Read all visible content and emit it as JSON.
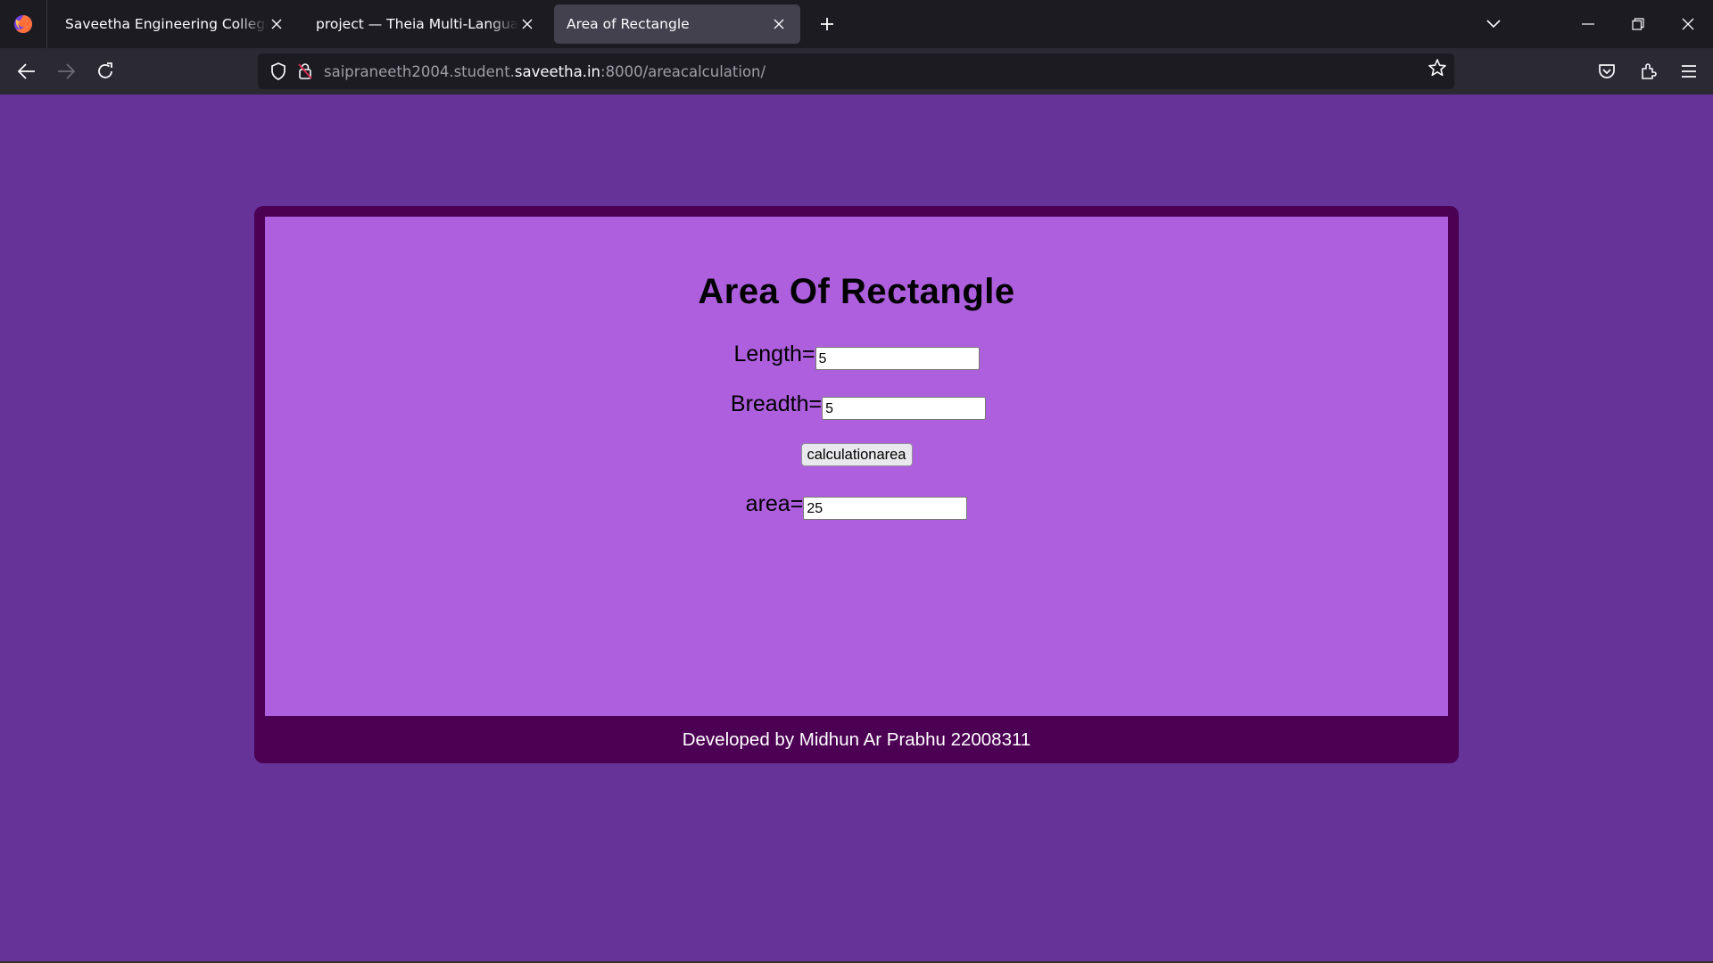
{
  "browser": {
    "tabs": [
      {
        "title": "Saveetha Engineering College",
        "active": false
      },
      {
        "title": "project — Theia Multi-Language Explorer",
        "active": false
      },
      {
        "title": "Area of Rectangle",
        "active": true
      }
    ],
    "url": {
      "prefix": "saipraneeth2004.student.",
      "domain": "saveetha.in",
      "suffix": ":8000/areacalculation/"
    }
  },
  "page": {
    "title": "Area Of Rectangle",
    "length_label": "Length=",
    "length_value": "5",
    "breadth_label": "Breadth=",
    "breadth_value": "5",
    "button_label": "calculationarea",
    "area_label": "area=",
    "area_value": "25",
    "footer": "Developed by Midhun Ar Prabhu 22008311"
  },
  "colors": {
    "page_background": "#663399",
    "card_border": "#4c0054",
    "card_background": "#ae5fde"
  },
  "icons": [
    "firefox-logo-icon",
    "close-icon",
    "plus-icon",
    "chevron-down-icon",
    "minimize-icon",
    "restore-icon",
    "back-arrow-icon",
    "forward-arrow-icon",
    "reload-icon",
    "shield-icon",
    "lock-icon",
    "star-icon",
    "pocket-icon",
    "extensions-icon",
    "menu-icon"
  ]
}
